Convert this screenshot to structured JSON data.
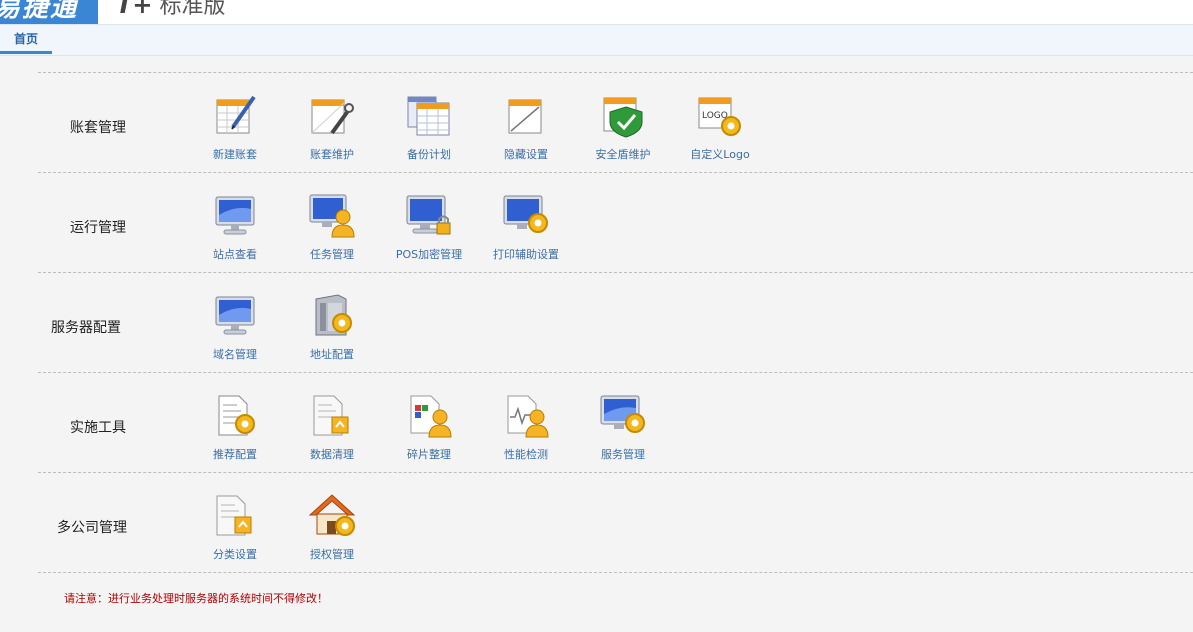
{
  "header": {
    "logo_text": "易捷通",
    "edition_prefix": "T+",
    "edition_text": "标准版"
  },
  "tabs": [
    {
      "label": "首页"
    }
  ],
  "sections": [
    {
      "title": "账套管理",
      "items": [
        {
          "label": "新建账套",
          "icon": "new-account-set-icon"
        },
        {
          "label": "账套维护",
          "icon": "account-set-maintenance-icon"
        },
        {
          "label": "备份计划",
          "icon": "backup-plan-icon"
        },
        {
          "label": "隐藏设置",
          "icon": "hidden-settings-icon"
        },
        {
          "label": "安全盾维护",
          "icon": "security-shield-icon"
        },
        {
          "label": "自定义Logo",
          "icon": "custom-logo-icon"
        }
      ]
    },
    {
      "title": "运行管理",
      "items": [
        {
          "label": "站点查看",
          "icon": "site-monitor-icon"
        },
        {
          "label": "任务管理",
          "icon": "task-monitor-user-icon"
        },
        {
          "label": "POS加密管理",
          "icon": "pos-encryption-monitor-icon"
        },
        {
          "label": "打印辅助设置",
          "icon": "print-assist-monitor-gear-icon"
        }
      ]
    },
    {
      "title": "服务器配置",
      "items": [
        {
          "label": "域名管理",
          "icon": "domain-monitor-icon"
        },
        {
          "label": "地址配置",
          "icon": "server-gear-icon"
        }
      ]
    },
    {
      "title": "实施工具",
      "items": [
        {
          "label": "推荐配置",
          "icon": "document-gear-icon"
        },
        {
          "label": "数据清理",
          "icon": "data-document-icon"
        },
        {
          "label": "碎片整理",
          "icon": "defrag-user-icon"
        },
        {
          "label": "性能检测",
          "icon": "performance-user-icon"
        },
        {
          "label": "服务管理",
          "icon": "service-monitor-gear-icon"
        }
      ]
    },
    {
      "title": "多公司管理",
      "items": [
        {
          "label": "分类设置",
          "icon": "category-document-icon"
        },
        {
          "label": "授权管理",
          "icon": "authorization-house-icon"
        }
      ]
    }
  ],
  "notice": "请注意：进行业务处理时服务器的系统时间不得修改！"
}
